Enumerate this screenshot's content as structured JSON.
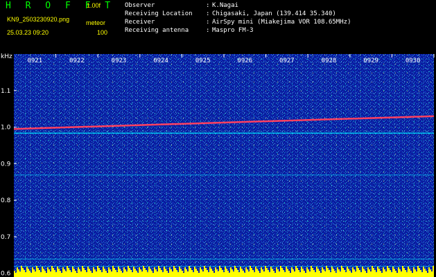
{
  "app": {
    "title": "H R O F F T",
    "version": "1.00f",
    "filename": "KN9_2503230920.png",
    "mode": "meteor",
    "datetime": "25.03.23 09:20",
    "count": "100"
  },
  "info": [
    {
      "label": "Observer",
      "value": "K.Nagai"
    },
    {
      "label": "Receiving Location",
      "value": "Chigasaki, Japan (139.414 35.340)"
    },
    {
      "label": "Receiver",
      "value": "AirSpy mini (Miakejima VOR 108.65MHz)"
    },
    {
      "label": "Receiving antenna",
      "value": "Maspro FM-3"
    }
  ],
  "colors": {
    "title": "#00ff00",
    "text_yellow": "#ffff00",
    "text_white": "#ffffff",
    "background_blue": "#0a1ea0",
    "axis": "#ffffff",
    "tick_label": "#ffffff",
    "meteor_trace": "#ff4060",
    "band_cyan": "#00e0ff"
  },
  "chart_data": {
    "type": "heatmap",
    "ylabel": "kHz",
    "x_ticks": [
      "0921",
      "0922",
      "0923",
      "0924",
      "0925",
      "0926",
      "0927",
      "0928",
      "0929",
      "0930"
    ],
    "y_ticks": [
      "1.1",
      "1.0",
      "0.9",
      "0.8",
      "0.7",
      "0.6"
    ],
    "ylim": [
      0.59,
      1.2
    ],
    "carrier_line": {
      "start_khz": 0.995,
      "end_khz": 1.03
    },
    "horizontal_bands_khz": [
      0.985,
      0.87,
      0.64,
      0.62
    ],
    "scale": "time (UTC HHMM) vs audio frequency"
  }
}
